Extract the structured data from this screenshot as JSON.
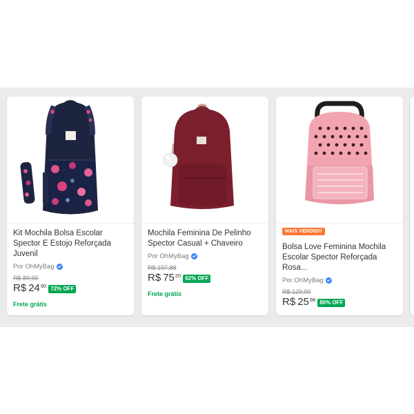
{
  "products": [
    {
      "title": "Kit Mochila Bolsa Escolar Spector E Estojo Reforçada Juvenil",
      "seller": "Por OhMyBag",
      "old_price": "R$ 89,90",
      "currency": "R$",
      "price_int": "24",
      "price_cents": "90",
      "discount": "72% OFF",
      "shipping": "Frete grátis",
      "image": "navy-floral-backpack-with-pencil-case"
    },
    {
      "title": "Mochila Feminina De Pelinho Spector Casual + Chaveiro",
      "seller": "Por OhMyBag",
      "old_price": "R$ 197,88",
      "currency": "R$",
      "price_int": "75",
      "price_cents": "20",
      "discount": "62% OFF",
      "shipping": "Frete grátis",
      "image": "burgundy-plush-backpack-with-pompom"
    },
    {
      "badge": "MAIS VENDIDO",
      "title": "Bolsa Love Feminina Mochila Escolar Spector Reforçada Rosa...",
      "seller": "Por OhMyBag",
      "old_price": "R$ 129,90",
      "currency": "R$",
      "price_int": "25",
      "price_cents": "98",
      "discount": "80% OFF",
      "image": "pink-hearts-love-backpack"
    }
  ],
  "colors": {
    "discount_green": "#00a650",
    "badge_orange": "#ff7733",
    "verified_blue": "#3483fa"
  }
}
